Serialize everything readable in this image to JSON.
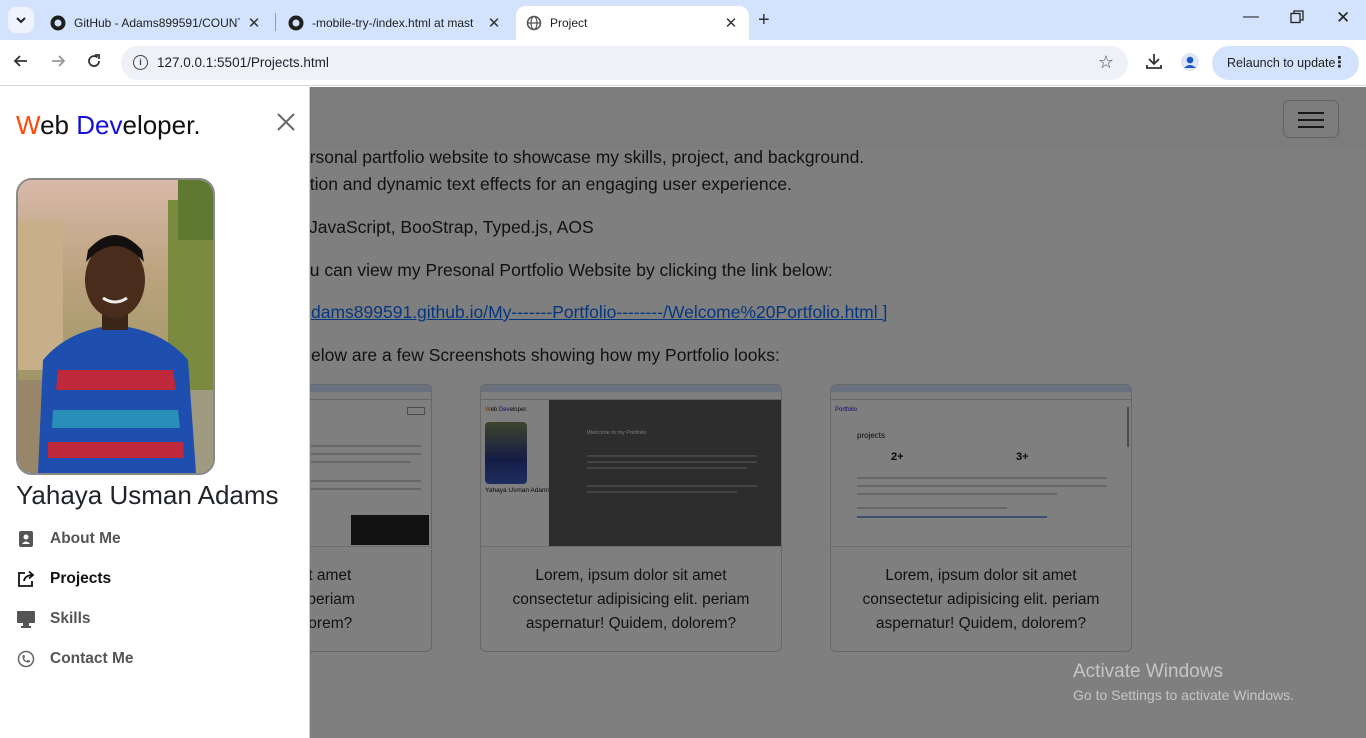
{
  "browser": {
    "tabs": [
      {
        "title": "GitHub - Adams899591/COUNT",
        "active": false
      },
      {
        "title": "-mobile-try-/index.html at mast",
        "active": false
      },
      {
        "title": "Project",
        "active": true
      }
    ],
    "url": "127.0.0.1:5501/Projects.html",
    "relaunch_label": "Relaunch to update"
  },
  "page": {
    "description_lines": [
      "ersonal partfolio website to showcase my skills, project, and background.",
      "ation and dynamic text effects for an engaging user experience."
    ],
    "tech_line": "JavaScript, BooStrap, Typed.js, AOS",
    "view_line": "ou can view my Presonal Portfolio Website by clicking the link below:",
    "link_text": "dams899591.github.io/My-------Portfolio--------/Welcome%20Portfolio.html ]",
    "screenshots_line": "elow are a few Screenshots showing how my Portfolio looks:",
    "cards": [
      {
        "caption": "or sit amet\nelit. periam\n, dolorem?"
      },
      {
        "caption": "Lorem, ipsum dolor sit amet\nconsectetur adipisicing elit. periam\naspernatur! Quidem, dolorem?"
      },
      {
        "caption": "Lorem, ipsum dolor sit amet\nconsectetur adipisicing elit. periam\naspernatur! Quidem, dolorem?"
      }
    ]
  },
  "watermark": {
    "line1": "Activate Windows",
    "line2": "Go to Settings to activate Windows."
  },
  "offcanvas": {
    "brand_w": "W",
    "brand_eb": "eb ",
    "brand_dev": "Dev",
    "brand_rest": "eloper.",
    "person_name": "Yahaya Usman Adams",
    "menu": [
      {
        "label": "About Me",
        "icon": "address-card-icon",
        "active": false
      },
      {
        "label": "Projects",
        "icon": "share-icon",
        "active": true
      },
      {
        "label": "Skills",
        "icon": "desktop-icon",
        "active": false
      },
      {
        "label": "Contact Me",
        "icon": "phone-icon",
        "active": false
      }
    ]
  }
}
